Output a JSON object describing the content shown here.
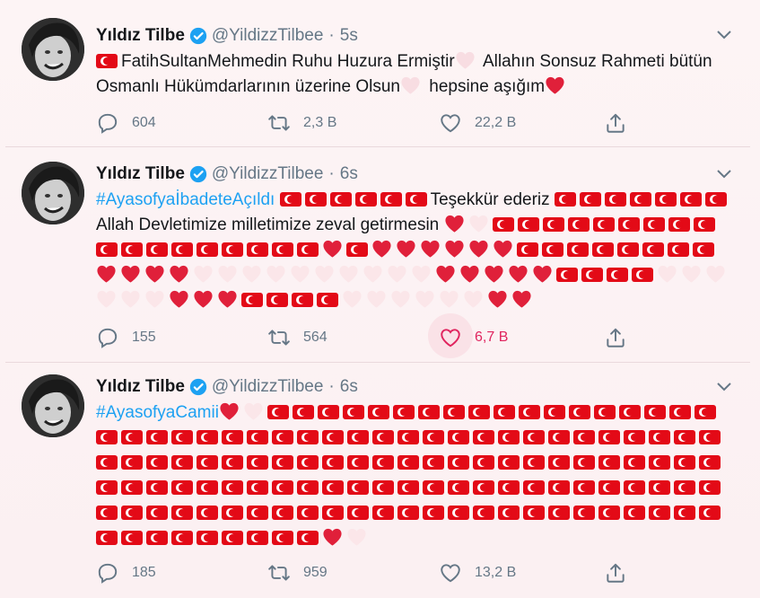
{
  "colors": {
    "accent": "#1da1f2",
    "flag_red": "#e30a17",
    "like_red": "#e0245e",
    "muted": "#657786"
  },
  "tweets": [
    {
      "name": "Yıldız Tilbe",
      "handle": "@YildizzTilbee",
      "sep": "·",
      "time": "5s",
      "text_segments": [
        {
          "type": "flag"
        },
        {
          "type": "text",
          "value": "FatihSultanMehmedin Ruhu Huzura Ermiştir"
        },
        {
          "type": "heart",
          "color": "#f8dde2"
        },
        {
          "type": "text",
          "value": " Allahın Sonsuz Rahmeti bütün Osmanlı Hükümdarlarının üzerine Olsun"
        },
        {
          "type": "heart",
          "color": "#f8dde2"
        },
        {
          "type": "text",
          "value": " hepsine aşığım"
        },
        {
          "type": "heart",
          "color": "#e0203a"
        }
      ],
      "reply_count": "604",
      "retweet_count": "2,3 B",
      "like_count": "22,2 B",
      "liked": false
    },
    {
      "name": "Yıldız Tilbe",
      "handle": "@YildizzTilbee",
      "sep": "·",
      "time": "6s",
      "text_segments": [
        {
          "type": "text",
          "value": "#AyasofyaİbadeteAçıldı",
          "hashtag": true
        },
        {
          "type": "text",
          "value": " "
        },
        {
          "type": "flag"
        },
        {
          "type": "flag"
        },
        {
          "type": "flag"
        },
        {
          "type": "flag"
        },
        {
          "type": "flag"
        },
        {
          "type": "flag"
        },
        {
          "type": "text",
          "value": "Teşekkür ederiz "
        },
        {
          "type": "flag"
        },
        {
          "type": "flag"
        },
        {
          "type": "flag"
        },
        {
          "type": "flag"
        },
        {
          "type": "flag"
        },
        {
          "type": "flag"
        },
        {
          "type": "flag"
        },
        {
          "type": "text",
          "value": " Allah Devletimize milletimize zeval getirmesin "
        },
        {
          "type": "heart",
          "color": "#e0203a"
        },
        {
          "type": "heart",
          "color": "#fbe6e9"
        },
        {
          "type": "flag"
        },
        {
          "type": "flag"
        },
        {
          "type": "flag"
        },
        {
          "type": "flag"
        },
        {
          "type": "flag"
        },
        {
          "type": "flag"
        },
        {
          "type": "flag"
        },
        {
          "type": "flag"
        },
        {
          "type": "flag"
        },
        {
          "type": "flag"
        },
        {
          "type": "flag"
        },
        {
          "type": "flag"
        },
        {
          "type": "flag"
        },
        {
          "type": "flag"
        },
        {
          "type": "flag"
        },
        {
          "type": "flag"
        },
        {
          "type": "flag"
        },
        {
          "type": "flag"
        },
        {
          "type": "heart",
          "color": "#e0203a"
        },
        {
          "type": "flag"
        },
        {
          "type": "heart",
          "color": "#e0203a"
        },
        {
          "type": "heart",
          "color": "#e0203a"
        },
        {
          "type": "heart",
          "color": "#e0203a"
        },
        {
          "type": "heart",
          "color": "#e0203a"
        },
        {
          "type": "heart",
          "color": "#e0203a"
        },
        {
          "type": "heart",
          "color": "#e0203a"
        },
        {
          "type": "flag"
        },
        {
          "type": "flag"
        },
        {
          "type": "flag"
        },
        {
          "type": "flag"
        },
        {
          "type": "flag"
        },
        {
          "type": "flag"
        },
        {
          "type": "flag"
        },
        {
          "type": "flag"
        },
        {
          "type": "heart",
          "color": "#e0203a"
        },
        {
          "type": "heart",
          "color": "#e0203a"
        },
        {
          "type": "heart",
          "color": "#e0203a"
        },
        {
          "type": "heart",
          "color": "#e0203a"
        },
        {
          "type": "heart",
          "color": "#fbe6e9"
        },
        {
          "type": "heart",
          "color": "#fbe6e9"
        },
        {
          "type": "heart",
          "color": "#fbe6e9"
        },
        {
          "type": "heart",
          "color": "#fbe6e9"
        },
        {
          "type": "heart",
          "color": "#fbe6e9"
        },
        {
          "type": "heart",
          "color": "#fbe6e9"
        },
        {
          "type": "heart",
          "color": "#fbe6e9"
        },
        {
          "type": "heart",
          "color": "#fbe6e9"
        },
        {
          "type": "heart",
          "color": "#fbe6e9"
        },
        {
          "type": "heart",
          "color": "#fbe6e9"
        },
        {
          "type": "heart",
          "color": "#e0203a"
        },
        {
          "type": "heart",
          "color": "#e0203a"
        },
        {
          "type": "heart",
          "color": "#e0203a"
        },
        {
          "type": "heart",
          "color": "#e0203a"
        },
        {
          "type": "heart",
          "color": "#e0203a"
        },
        {
          "type": "flag"
        },
        {
          "type": "flag"
        },
        {
          "type": "flag"
        },
        {
          "type": "flag"
        },
        {
          "type": "heart",
          "color": "#fbe6e9"
        },
        {
          "type": "heart",
          "color": "#fbe6e9"
        },
        {
          "type": "heart",
          "color": "#fbe6e9"
        },
        {
          "type": "heart",
          "color": "#fbe6e9"
        },
        {
          "type": "heart",
          "color": "#fbe6e9"
        },
        {
          "type": "heart",
          "color": "#fbe6e9"
        },
        {
          "type": "heart",
          "color": "#e0203a"
        },
        {
          "type": "heart",
          "color": "#e0203a"
        },
        {
          "type": "heart",
          "color": "#e0203a"
        },
        {
          "type": "flag"
        },
        {
          "type": "flag"
        },
        {
          "type": "flag"
        },
        {
          "type": "flag"
        },
        {
          "type": "heart",
          "color": "#fbe6e9"
        },
        {
          "type": "heart",
          "color": "#fbe6e9"
        },
        {
          "type": "heart",
          "color": "#fbe6e9"
        },
        {
          "type": "heart",
          "color": "#fbe6e9"
        },
        {
          "type": "heart",
          "color": "#fbe6e9"
        },
        {
          "type": "heart",
          "color": "#fbe6e9"
        },
        {
          "type": "heart",
          "color": "#e0203a"
        },
        {
          "type": "heart",
          "color": "#e0203a"
        }
      ],
      "reply_count": "155",
      "retweet_count": "564",
      "like_count": "6,7 B",
      "liked": true
    },
    {
      "name": "Yıldız Tilbe",
      "handle": "@YildizzTilbee",
      "sep": "·",
      "time": "6s",
      "text_segments": [
        {
          "type": "text",
          "value": "#AyasofyaCamii",
          "hashtag": true
        },
        {
          "type": "heart",
          "color": "#e0203a"
        },
        {
          "type": "heart",
          "color": "#fbe6e9"
        },
        {
          "type": "flag"
        },
        {
          "type": "flag"
        },
        {
          "type": "flag"
        },
        {
          "type": "flag"
        },
        {
          "type": "flag"
        },
        {
          "type": "flag"
        },
        {
          "type": "flag"
        },
        {
          "type": "flag"
        },
        {
          "type": "flag"
        },
        {
          "type": "flag"
        },
        {
          "type": "flag"
        },
        {
          "type": "flag"
        },
        {
          "type": "flag"
        },
        {
          "type": "flag"
        },
        {
          "type": "flag"
        },
        {
          "type": "flag"
        },
        {
          "type": "flag"
        },
        {
          "type": "flag"
        },
        {
          "type": "flag"
        },
        {
          "type": "flag"
        },
        {
          "type": "flag"
        },
        {
          "type": "flag"
        },
        {
          "type": "flag"
        },
        {
          "type": "flag"
        },
        {
          "type": "flag"
        },
        {
          "type": "flag"
        },
        {
          "type": "flag"
        },
        {
          "type": "flag"
        },
        {
          "type": "flag"
        },
        {
          "type": "flag"
        },
        {
          "type": "flag"
        },
        {
          "type": "flag"
        },
        {
          "type": "flag"
        },
        {
          "type": "flag"
        },
        {
          "type": "flag"
        },
        {
          "type": "flag"
        },
        {
          "type": "flag"
        },
        {
          "type": "flag"
        },
        {
          "type": "flag"
        },
        {
          "type": "flag"
        },
        {
          "type": "flag"
        },
        {
          "type": "flag"
        },
        {
          "type": "flag"
        },
        {
          "type": "flag"
        },
        {
          "type": "flag"
        },
        {
          "type": "flag"
        },
        {
          "type": "flag"
        },
        {
          "type": "flag"
        },
        {
          "type": "flag"
        },
        {
          "type": "flag"
        },
        {
          "type": "flag"
        },
        {
          "type": "flag"
        },
        {
          "type": "flag"
        },
        {
          "type": "flag"
        },
        {
          "type": "flag"
        },
        {
          "type": "flag"
        },
        {
          "type": "flag"
        },
        {
          "type": "flag"
        },
        {
          "type": "flag"
        },
        {
          "type": "flag"
        },
        {
          "type": "flag"
        },
        {
          "type": "flag"
        },
        {
          "type": "flag"
        },
        {
          "type": "flag"
        },
        {
          "type": "flag"
        },
        {
          "type": "flag"
        },
        {
          "type": "flag"
        },
        {
          "type": "flag"
        },
        {
          "type": "flag"
        },
        {
          "type": "flag"
        },
        {
          "type": "flag"
        },
        {
          "type": "flag"
        },
        {
          "type": "flag"
        },
        {
          "type": "flag"
        },
        {
          "type": "flag"
        },
        {
          "type": "flag"
        },
        {
          "type": "flag"
        },
        {
          "type": "flag"
        },
        {
          "type": "flag"
        },
        {
          "type": "flag"
        },
        {
          "type": "flag"
        },
        {
          "type": "flag"
        },
        {
          "type": "flag"
        },
        {
          "type": "flag"
        },
        {
          "type": "flag"
        },
        {
          "type": "flag"
        },
        {
          "type": "flag"
        },
        {
          "type": "flag"
        },
        {
          "type": "flag"
        },
        {
          "type": "flag"
        },
        {
          "type": "flag"
        },
        {
          "type": "flag"
        },
        {
          "type": "flag"
        },
        {
          "type": "flag"
        },
        {
          "type": "flag"
        },
        {
          "type": "flag"
        },
        {
          "type": "flag"
        },
        {
          "type": "flag"
        },
        {
          "type": "flag"
        },
        {
          "type": "flag"
        },
        {
          "type": "flag"
        },
        {
          "type": "flag"
        },
        {
          "type": "flag"
        },
        {
          "type": "flag"
        },
        {
          "type": "flag"
        },
        {
          "type": "flag"
        },
        {
          "type": "flag"
        },
        {
          "type": "flag"
        },
        {
          "type": "flag"
        },
        {
          "type": "flag"
        },
        {
          "type": "flag"
        },
        {
          "type": "flag"
        },
        {
          "type": "flag"
        },
        {
          "type": "flag"
        },
        {
          "type": "flag"
        },
        {
          "type": "flag"
        },
        {
          "type": "flag"
        },
        {
          "type": "flag"
        },
        {
          "type": "flag"
        },
        {
          "type": "flag"
        },
        {
          "type": "flag"
        },
        {
          "type": "flag"
        },
        {
          "type": "flag"
        },
        {
          "type": "flag"
        },
        {
          "type": "flag"
        },
        {
          "type": "flag"
        },
        {
          "type": "flag"
        },
        {
          "type": "heart",
          "color": "#e0203a"
        },
        {
          "type": "heart",
          "color": "#fbe6e9"
        }
      ],
      "reply_count": "185",
      "retweet_count": "959",
      "like_count": "13,2 B",
      "liked": false
    }
  ]
}
